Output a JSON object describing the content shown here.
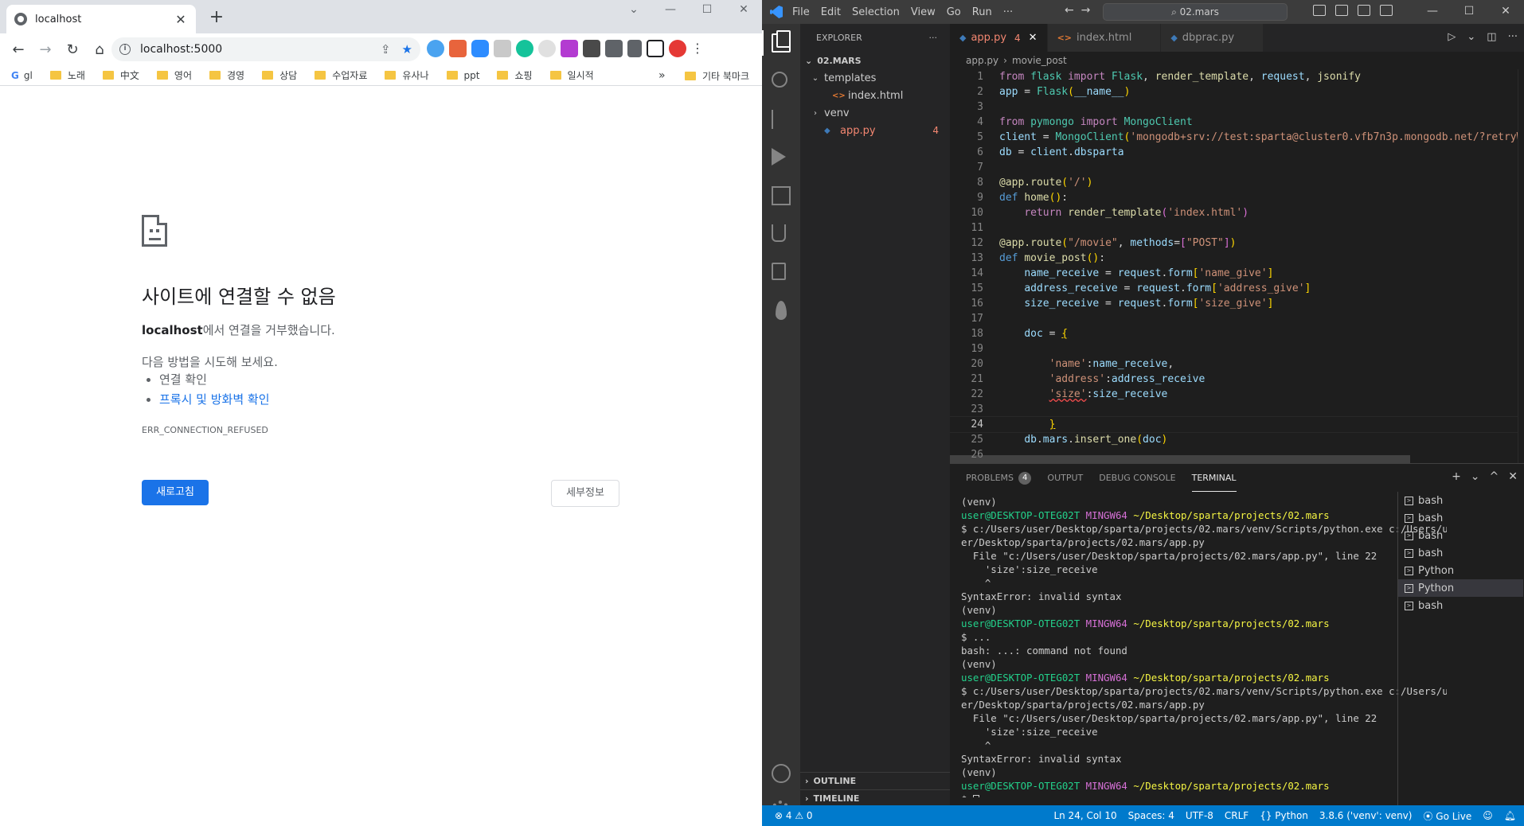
{
  "chrome": {
    "tab_title": "localhost",
    "url": "localhost:5000",
    "bookmarks": [
      {
        "label": "gl",
        "type": "g"
      },
      {
        "label": "노래",
        "type": "folder"
      },
      {
        "label": "中文",
        "type": "folder"
      },
      {
        "label": "영어",
        "type": "folder"
      },
      {
        "label": "경영",
        "type": "folder"
      },
      {
        "label": "상담",
        "type": "folder"
      },
      {
        "label": "수업자료",
        "type": "folder"
      },
      {
        "label": "유사나",
        "type": "folder"
      },
      {
        "label": "ppt",
        "type": "folder"
      },
      {
        "label": "쇼핑",
        "type": "folder"
      },
      {
        "label": "일시적",
        "type": "folder"
      }
    ],
    "bookmarks_more": "»",
    "other_bookmarks": "기타 북마크",
    "error": {
      "title": "사이트에 연결할 수 없음",
      "host": "localhost",
      "host_suffix": "에서 연결을 거부했습니다.",
      "try_heading": "다음 방법을 시도해 보세요.",
      "suggestions": [
        "연결 확인",
        "프록시 및 방화벽 확인"
      ],
      "code": "ERR_CONNECTION_REFUSED",
      "reload_button": "새로고침",
      "details_button": "세부정보"
    }
  },
  "vscode": {
    "menu": [
      "File",
      "Edit",
      "Selection",
      "View",
      "Go",
      "Run",
      "···"
    ],
    "search_text": "⌕ 02.mars",
    "explorer": {
      "header": "EXPLORER",
      "root": "02.MARS",
      "items": [
        {
          "label": "templates",
          "kind": "folder-open",
          "indent": 1
        },
        {
          "label": "index.html",
          "kind": "html",
          "indent": 2
        },
        {
          "label": "venv",
          "kind": "folder",
          "indent": 1
        },
        {
          "label": "app.py",
          "kind": "py",
          "indent": 1,
          "badge": "4"
        }
      ],
      "outline": "OUTLINE",
      "timeline": "TIMELINE"
    },
    "tabs": [
      {
        "label": "app.py",
        "count": "4",
        "active": true,
        "icon": "py"
      },
      {
        "label": "index.html",
        "active": false,
        "icon": "html"
      },
      {
        "label": "dbprac.py",
        "active": false,
        "icon": "py"
      }
    ],
    "breadcrumb": [
      "app.py",
      "movie_post"
    ],
    "code_lines": [
      "1",
      "2",
      "3",
      "4",
      "5",
      "6",
      "7",
      "8",
      "9",
      "10",
      "11",
      "12",
      "13",
      "14",
      "15",
      "16",
      "17",
      "18",
      "19",
      "20",
      "21",
      "22",
      "23",
      "24",
      "25",
      "26"
    ],
    "panel_tabs": [
      "PROBLEMS",
      "OUTPUT",
      "DEBUG CONSOLE",
      "TERMINAL"
    ],
    "problems_count": "4",
    "terminal": {
      "user": "user@DESKTOP-OTEG02T",
      "host": "MINGW64",
      "path": "~/Desktop/sparta/projects/02.mars",
      "venv": "(venv)",
      "run_cmd_1": "$ c:/Users/user/Desktop/sparta/projects/02.mars/venv/Scripts/python.exe c:/Users/us",
      "run_cmd_2": "er/Desktop/sparta/projects/02.mars/app.py",
      "file_line": "  File \"c:/Users/user/Desktop/sparta/projects/02.mars/app.py\", line 22",
      "src_line": "    'size':size_receive",
      "caret": "    ^",
      "syntax_error": "SyntaxError: invalid syntax",
      "dots_cmd": "$ ...",
      "not_found": "bash: ...: command not found",
      "prompt": "$ "
    },
    "terminal_list": [
      "bash",
      "bash",
      "bash",
      "bash",
      "Python",
      "Python",
      "bash"
    ],
    "status": {
      "errors": "⊗ 4 ⚠ 0",
      "position": "Ln 24, Col 10",
      "spaces": "Spaces: 4",
      "encoding": "UTF-8",
      "eol": "CRLF",
      "language": "{} Python",
      "interpreter": "3.8.6 ('venv': venv)",
      "golive": "⦿ Go Live"
    }
  }
}
